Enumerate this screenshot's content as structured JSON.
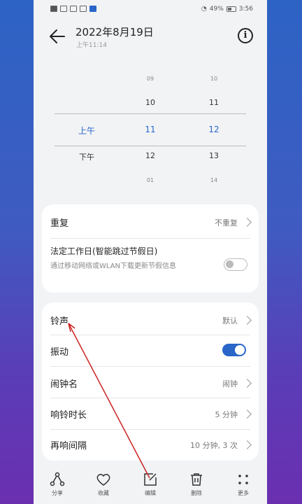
{
  "status_bar": {
    "battery": "49%",
    "time": "3:56"
  },
  "header": {
    "title": "2022年8月19日",
    "subtitle": "上午11:14"
  },
  "picker": {
    "period": {
      "selected": "上午",
      "next": "下午"
    },
    "hour": [
      "09",
      "10",
      "11",
      "12",
      "01"
    ],
    "minute": [
      "10",
      "11",
      "12",
      "13",
      "14"
    ],
    "selected_index": 2
  },
  "card1": {
    "repeat": {
      "label": "重复",
      "value": "不重复"
    },
    "workday": {
      "label": "法定工作日(智能跳过节假日)",
      "desc": "通过移动网络或WLAN下载更新节假信息",
      "enabled": false
    }
  },
  "card2": {
    "ringtone": {
      "label": "铃声",
      "value": "默认"
    },
    "vibrate": {
      "label": "振动",
      "enabled": true
    },
    "alarm_name": {
      "label": "闹钟名",
      "value": "闹钟"
    },
    "ring_duration": {
      "label": "响铃时长",
      "value": "5 分钟"
    },
    "snooze": {
      "label": "再响间隔",
      "value": "10 分钟, 3 次"
    }
  },
  "bottom_bar": {
    "share": "分享",
    "favorite": "收藏",
    "edit": "编辑",
    "delete": "删除",
    "more": "更多"
  },
  "colors": {
    "accent": "#2a66c9",
    "annotation": "#cc2222"
  }
}
